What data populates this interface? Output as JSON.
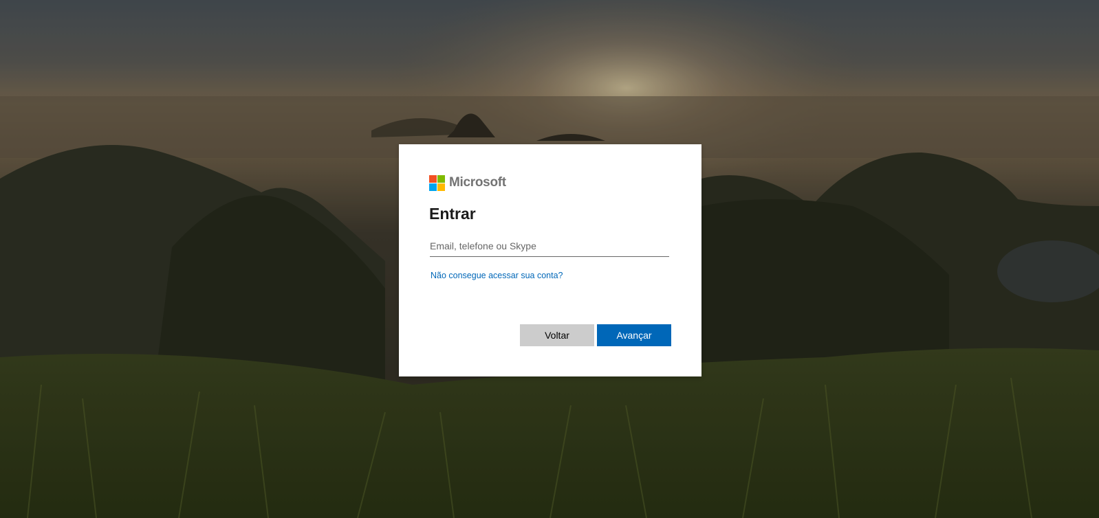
{
  "colors": {
    "accent": "#0067b8",
    "secondary_button": "#cccccc",
    "logo_red": "#f25022",
    "logo_green": "#7fba00",
    "logo_blue": "#00a4ef",
    "logo_yellow": "#ffb900"
  },
  "background": {
    "description_icon": "landscape-photo"
  },
  "dialog": {
    "brand": "Microsoft",
    "title": "Entrar",
    "email_input": {
      "value": "",
      "placeholder": "Email, telefone ou Skype"
    },
    "help_link": "Não consegue acessar sua conta?",
    "back_button": "Voltar",
    "next_button": "Avançar"
  }
}
